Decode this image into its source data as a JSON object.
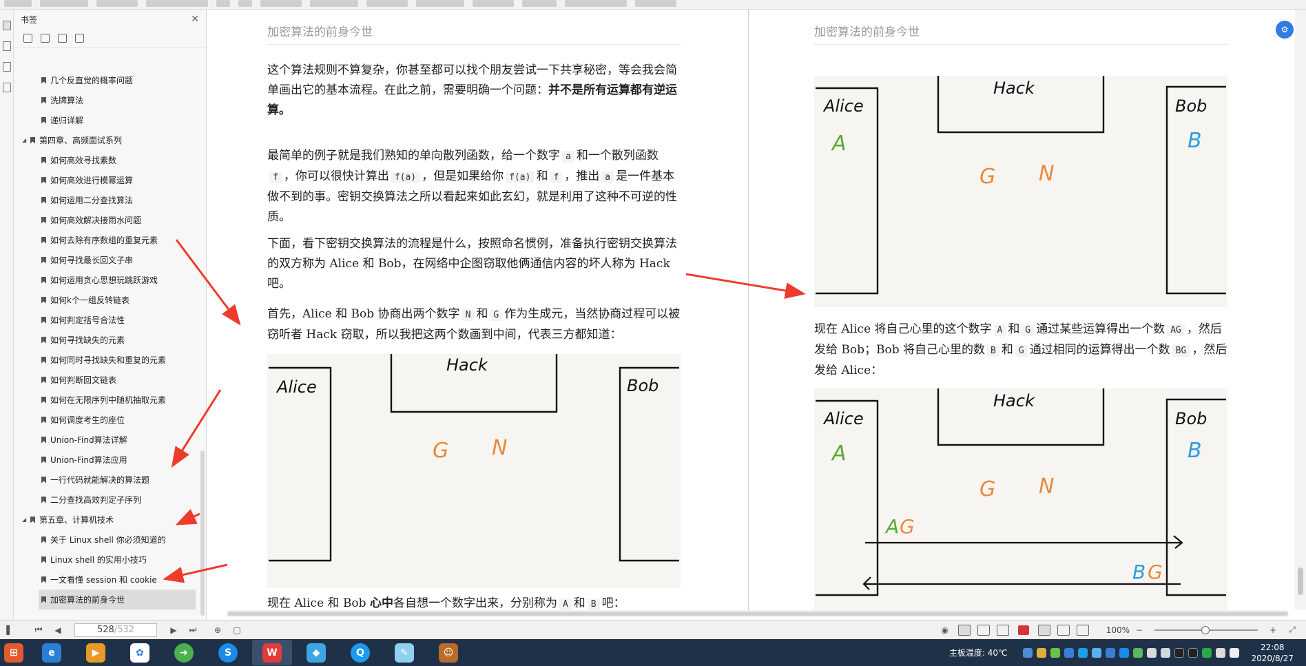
{
  "bookmarks": {
    "title": "书签",
    "items": [
      {
        "label": "几个反直觉的概率问题",
        "level": 2
      },
      {
        "label": "洗牌算法",
        "level": 2
      },
      {
        "label": "递归详解",
        "level": 2
      },
      {
        "label": "第四章、高频面试系列",
        "level": 1
      },
      {
        "label": "如何高效寻找素数",
        "level": 2
      },
      {
        "label": "如何高效进行模幂运算",
        "level": 2
      },
      {
        "label": "如何运用二分查找算法",
        "level": 2
      },
      {
        "label": "如何高效解决接雨水问题",
        "level": 2
      },
      {
        "label": "如何去除有序数组的重复元素",
        "level": 2
      },
      {
        "label": "如何寻找最长回文子串",
        "level": 2
      },
      {
        "label": "如何运用贪心思想玩跳跃游戏",
        "level": 2
      },
      {
        "label": "如何k个一组反转链表",
        "level": 2
      },
      {
        "label": "如何判定括号合法性",
        "level": 2
      },
      {
        "label": "如何寻找缺失的元素",
        "level": 2
      },
      {
        "label": "如何同时寻找缺失和重复的元素",
        "level": 2
      },
      {
        "label": "如何判断回文链表",
        "level": 2
      },
      {
        "label": "如何在无限序列中随机抽取元素",
        "level": 2
      },
      {
        "label": "如何调度考生的座位",
        "level": 2
      },
      {
        "label": "Union-Find算法详解",
        "level": 2
      },
      {
        "label": "Union-Find算法应用",
        "level": 2
      },
      {
        "label": "一行代码就能解决的算法题",
        "level": 2
      },
      {
        "label": "二分查找高效判定子序列",
        "level": 2
      },
      {
        "label": "第五章、计算机技术",
        "level": 1
      },
      {
        "label": "关于 Linux shell 你必须知道的",
        "level": 2
      },
      {
        "label": "Linux shell 的实用小技巧",
        "level": 2
      },
      {
        "label": "一文看懂 session 和 cookie",
        "level": 2
      },
      {
        "label": "加密算法的前身今世",
        "level": 2,
        "active": true
      }
    ]
  },
  "left_page": {
    "running_head": "加密算法的前身今世",
    "p1a": "这个算法规则不算复杂，你甚至都可以找个朋友尝试一下共享秘密，等会我会简单画出它的基本流程。在此之前，需要明确一个问题：",
    "p1b": "并不是所有运算都有逆运算。",
    "p2a": "最简单的例子就是我们熟知的单向散列函数，给一个数字",
    "p2_code_a": "a",
    "p2b": "和一个散列函数",
    "p2_code_f": "f",
    "p2c": "，你可以很快计算出",
    "p2_code_fa": "f(a)",
    "p2d": "，但是如果给你",
    "p2_code_fa2": "f(a)",
    "p2e": "和",
    "p2_code_f2": "f",
    "p2f": "，推出",
    "p2_code_a2": "a",
    "p2g": "是一件基本做不到的事。密钥交换算法之所以看起来如此玄幻，就是利用了这种不可逆的性质。",
    "p3": "下面，看下密钥交换算法的流程是什么，按照命名惯例，准备执行密钥交换算法的双方称为 Alice 和 Bob，在网络中企图窃取他俩通信内容的坏人称为 Hack 吧。",
    "p4a": "首先，Alice 和 Bob 协商出两个数字",
    "p4_code_n": "N",
    "p4b": "和",
    "p4_code_g": "G",
    "p4c": "作为生成元，当然协商过程可以被窃听者 Hack 窃取，所以我把这两个数画到中间，代表三方都知道：",
    "p5a": "现在 Alice 和 Bob ",
    "p5b": "心中",
    "p5c": "各自想一个数字出来，分别称为",
    "p5_code_a": "A",
    "p5d": "和",
    "p5_code_b": "B",
    "p5e": "吧："
  },
  "right_page": {
    "running_head": "加密算法的前身今世",
    "p1a": "现在 Alice 将自己心里的这个数字",
    "p1_code_a": "A",
    "p1b": "和",
    "p1_code_g": "G",
    "p1c": "通过某些运算得出一个数",
    "p1_code_ag": "AG",
    "p1d": "，然后发给 Bob；Bob 将自己心里的数",
    "p1_code_b": "B",
    "p1e": "和",
    "p1_code_g2": "G",
    "p1f": "通过相同的运算得出一个数",
    "p1_code_bg": "BG",
    "p1g": "，然后发给 Alice："
  },
  "figure": {
    "alice": "Alice",
    "bob": "Bob",
    "hack": "Hack",
    "g": "G",
    "n": "N",
    "a": "A",
    "b": "B",
    "ag_a": "A",
    "ag_g": "G",
    "bg_b": "B",
    "bg_g": "G"
  },
  "statusbar": {
    "page_current": "528",
    "page_total": "/532",
    "zoom": "100%"
  },
  "taskbar": {
    "temp": "主板温度: 40℃",
    "time": "22:08",
    "date": "2020/8/27"
  },
  "colors": {
    "green": "#5aa832",
    "blue": "#2a9de0",
    "orange": "#e8893a",
    "arrow": "#ee3b2c"
  }
}
